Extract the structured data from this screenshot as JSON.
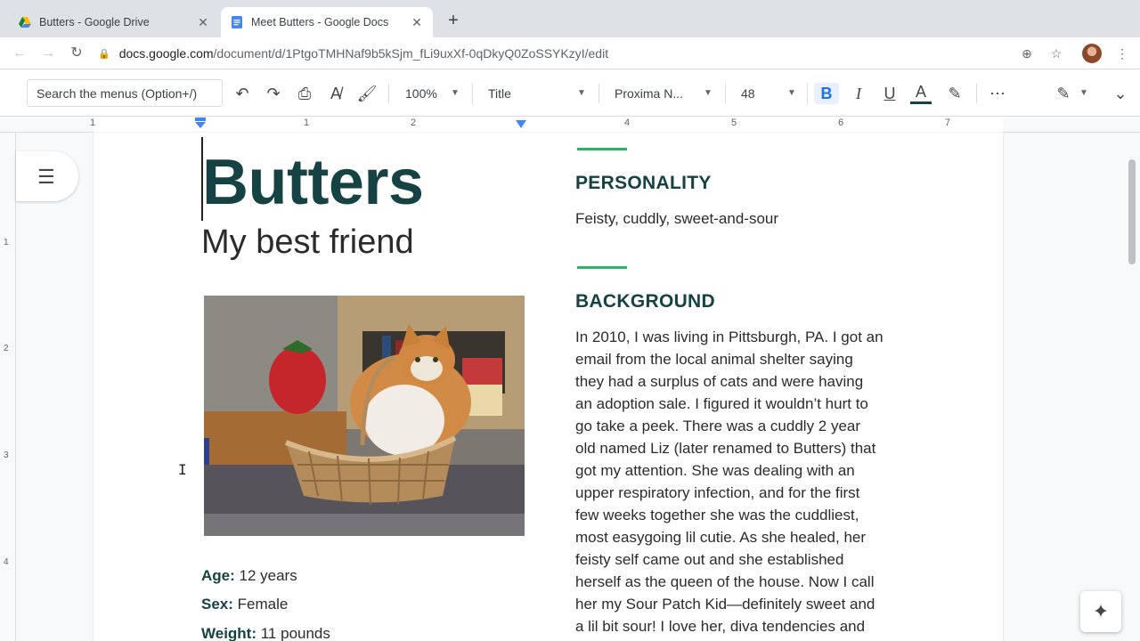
{
  "browser": {
    "tabs": [
      {
        "title": "Butters - Google Drive",
        "icon": "google-drive-icon"
      },
      {
        "title": "Meet Butters - Google Docs",
        "icon": "google-docs-icon"
      }
    ],
    "url_host": "docs.google.com",
    "url_path": "/document/d/1PtgoTMHNaf9b5kSjm_fLi9uxXf-0qDkyQ0ZoSSYKzyI/edit"
  },
  "toolbar": {
    "search_placeholder": "Search the menus (Option+/)",
    "zoom": "100%",
    "style": "Title",
    "font": "Proxima N...",
    "font_size": "48"
  },
  "ruler": {
    "horizontal": [
      "1",
      "1",
      "2",
      "4",
      "5",
      "6",
      "7"
    ],
    "vertical": [
      "1",
      "2",
      "3",
      "4"
    ]
  },
  "doc": {
    "title": "Butters",
    "subtitle": "My best friend",
    "facts": [
      {
        "label": "Age:",
        "value": " 12 years"
      },
      {
        "label": "Sex:",
        "value": " Female"
      },
      {
        "label": "Weight:",
        "value": " 11 pounds"
      }
    ],
    "personality_heading": "PERSONALITY",
    "personality_text": "Feisty, cuddly, sweet-and-sour",
    "background_heading": "BACKGROUND",
    "background_lines": [
      "In 2010, I was living in Pittsburgh, PA. I got an",
      "email from the local animal shelter saying",
      "they had a surplus of cats and were having",
      "an adoption sale. I figured it wouldn’t hurt to",
      "go take a peek. There was a cuddly 2 year",
      "old named Liz (later renamed to Butters) that",
      "got my attention. She was dealing with an",
      "upper respiratory infection, and for the first",
      "few weeks together she was the cuddliest,",
      "most easygoing lil cutie. As she healed, her",
      "feisty self came out and she established",
      "herself as the queen of the house. Now I call",
      "her my Sour Patch Kid—definitely sweet and",
      "a lil bit sour! I love her, diva tendencies and"
    ]
  },
  "colors": {
    "heading": "#164244",
    "accent_divider": "#28b463",
    "bold_active": "#1a73e8"
  }
}
